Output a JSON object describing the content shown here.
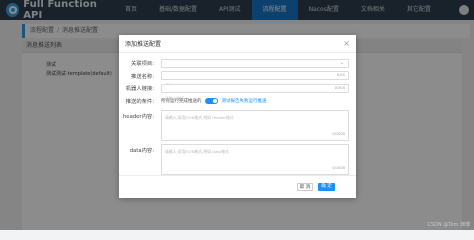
{
  "app": {
    "title": "Full Function API"
  },
  "nav": [
    {
      "label": "首页"
    },
    {
      "label": "基础/数据配置"
    },
    {
      "label": "API测试"
    },
    {
      "label": "流程配置"
    },
    {
      "label": "Nacos配置"
    },
    {
      "label": "文档相关"
    },
    {
      "label": "其它配置"
    }
  ],
  "breadcrumb": {
    "parent": "流程配置",
    "current": "消息推送配置"
  },
  "panel": {
    "title": "消息推送列表",
    "tree_items": [
      "测试",
      "测试测试-template(default)"
    ]
  },
  "dialog": {
    "title": "添加推送配置",
    "fields": [
      {
        "label": "关联项目:",
        "placeholder": "请选择关联的项目",
        "counter": ""
      },
      {
        "label": "推送名称:",
        "placeholder": "请输入名字",
        "counter": "0/50"
      },
      {
        "label": "机器人链接:",
        "placeholder": "请输入链接",
        "counter": "0/300"
      }
    ],
    "condition": {
      "label": "推送的条件:",
      "text_left": "所有运行完成推送的",
      "text_right": "测试报告失败运行推送"
    },
    "header": {
      "label": "header内容:",
      "placeholder": "请输入,采用JSON格式,例如 Header格式",
      "counter": "0/1000"
    },
    "data": {
      "label": "data内容:",
      "placeholder": "请输入,采用JSON格式,例如 Data格式",
      "counter": "0/1000"
    },
    "buttons": {
      "cancel": "取 消",
      "ok": "确 定"
    }
  },
  "watermark": "CSDN @Tom 渊博"
}
